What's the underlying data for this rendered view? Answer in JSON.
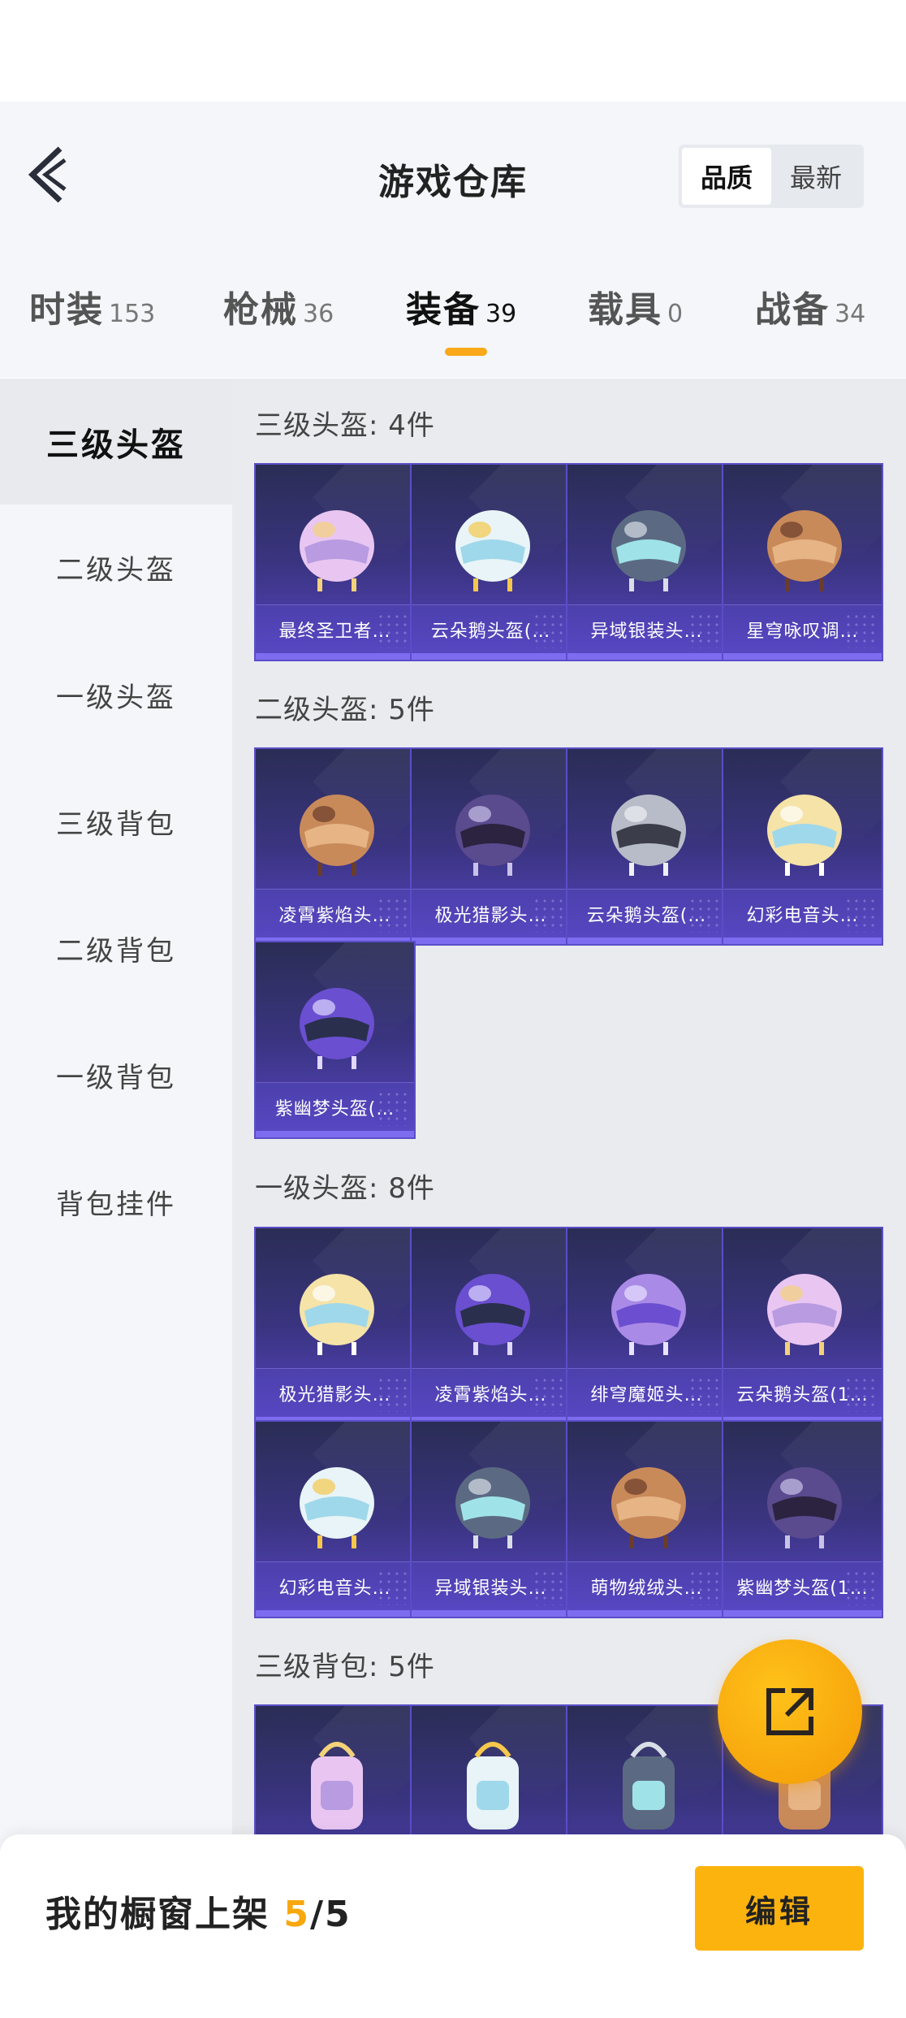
{
  "header": {
    "title": "游戏仓库",
    "sort_options": [
      {
        "label": "品质",
        "active": true
      },
      {
        "label": "最新",
        "active": false
      }
    ]
  },
  "tabs": [
    {
      "label": "时装",
      "count": "153",
      "active": false
    },
    {
      "label": "枪械",
      "count": "36",
      "active": false
    },
    {
      "label": "装备",
      "count": "39",
      "active": true
    },
    {
      "label": "载具",
      "count": "0",
      "active": false
    },
    {
      "label": "战备",
      "count": "34",
      "active": false
    }
  ],
  "sidebar": {
    "items": [
      {
        "label": "三级头盔",
        "active": true
      },
      {
        "label": "二级头盔",
        "active": false
      },
      {
        "label": "一级头盔",
        "active": false
      },
      {
        "label": "三级背包",
        "active": false
      },
      {
        "label": "二级背包",
        "active": false
      },
      {
        "label": "一级背包",
        "active": false
      },
      {
        "label": "背包挂件",
        "active": false
      }
    ]
  },
  "sections": [
    {
      "title": "三级头盔: 4件",
      "items": [
        "最终圣卫者…",
        "云朵鹅头盔(…",
        "异域银装头…",
        "星穹咏叹调…"
      ]
    },
    {
      "title": "二级头盔: 5件",
      "items": [
        "凌霄紫焰头…",
        "极光猎影头…",
        "云朵鹅头盔(…",
        "幻彩电音头…",
        "紫幽梦头盔(…"
      ]
    },
    {
      "title": "一级头盔: 8件",
      "items": [
        "极光猎影头…",
        "凌霄紫焰头…",
        "绯穹魔姬头…",
        "云朵鹅头盔(1…",
        "幻彩电音头…",
        "异域银装头…",
        "萌物绒绒头…",
        "紫幽梦头盔(1…"
      ]
    },
    {
      "title": "三级背包: 5件",
      "items": [
        "",
        "",
        "",
        ""
      ]
    }
  ],
  "bottom_bar": {
    "label": "我的橱窗上架",
    "count": "5",
    "total": "/5",
    "edit_label": "编辑"
  },
  "colors": {
    "accent": "#f7a80e",
    "card_purple": "#3a3480",
    "background": "#f4f6f9"
  },
  "icons": {
    "back": "chevron-left-icon",
    "fab": "share-external-icon"
  }
}
